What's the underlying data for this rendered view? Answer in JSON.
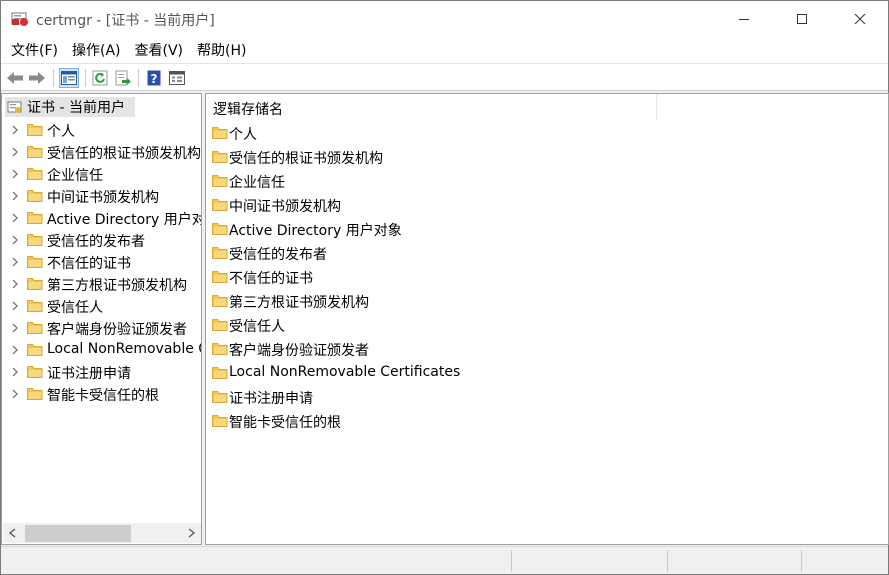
{
  "window": {
    "title": "certmgr - [证书 - 当前用户]",
    "minimize_icon": "minimize-icon",
    "maximize_icon": "maximize-icon",
    "close_icon": "close-icon"
  },
  "menu": {
    "items": [
      "文件(F)",
      "操作(A)",
      "查看(V)",
      "帮助(H)"
    ]
  },
  "toolbar": {
    "icons": [
      "back-arrow-icon",
      "forward-arrow-icon",
      "show-hide-console-tree-icon",
      "refresh-icon",
      "export-list-icon",
      "help-icon",
      "properties-icon"
    ]
  },
  "tree": {
    "root_label": "证书 - 当前用户",
    "items": [
      "个人",
      "受信任的根证书颁发机构",
      "企业信任",
      "中间证书颁发机构",
      "Active Directory 用户对象",
      "受信任的发布者",
      "不信任的证书",
      "第三方根证书颁发机构",
      "受信任人",
      "客户端身份验证颁发者",
      "Local NonRemovable Certificates",
      "证书注册申请",
      "智能卡受信任的根"
    ]
  },
  "list": {
    "column_header": "逻辑存储名",
    "items": [
      "个人",
      "受信任的根证书颁发机构",
      "企业信任",
      "中间证书颁发机构",
      "Active Directory 用户对象",
      "受信任的发布者",
      "不信任的证书",
      "第三方根证书颁发机构",
      "受信任人",
      "客户端身份验证颁发者",
      "Local NonRemovable Certificates",
      "证书注册申请",
      "智能卡受信任的根"
    ]
  },
  "colors": {
    "folder": "#f3c55b",
    "folder_dark": "#d9a734",
    "selected_bg": "#e5e5e5",
    "pressed_toolbar": "#cce4f7"
  }
}
